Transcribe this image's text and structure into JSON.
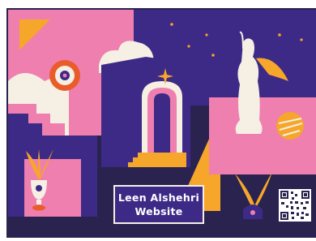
{
  "title_lines": [
    "Leen Alshehri",
    "Website"
  ],
  "colors": {
    "indigo": "#3d2a86",
    "navy": "#2a2350",
    "pink": "#ee7fae",
    "orange": "#f6a62a",
    "cream": "#f6efe4",
    "white": "#ffffff"
  },
  "icons": [
    "eye-icon",
    "sparkle-icon",
    "star-icon",
    "trophy-icon",
    "plant-icon",
    "moon-icon",
    "qr-code-icon"
  ]
}
